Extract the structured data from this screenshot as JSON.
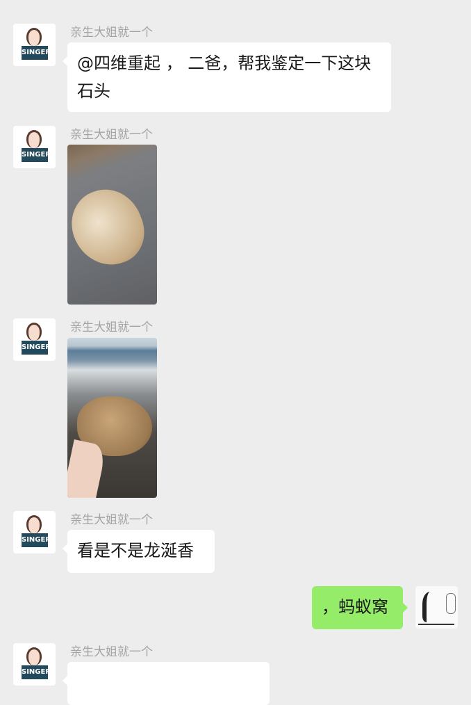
{
  "messages": [
    {
      "sender": "亲生大姐就一个",
      "side": "left",
      "type": "text",
      "text": "@四维重起 ， 二爸，帮我鉴定一下这块石头"
    },
    {
      "sender": "亲生大姐就一个",
      "side": "left",
      "type": "image",
      "icon": "photo-stone-on-sand"
    },
    {
      "sender": "亲生大姐就一个",
      "side": "left",
      "type": "image",
      "icon": "photo-stone-in-hand-beach"
    },
    {
      "sender": "亲生大姐就一个",
      "side": "left",
      "type": "text",
      "text": "看是不是龙涎香"
    },
    {
      "side": "right",
      "type": "text",
      "text": "，蚂蚁窝"
    },
    {
      "sender": "亲生大姐就一个",
      "side": "left",
      "type": "text",
      "text": ""
    }
  ],
  "avatar_logo": "SINGER",
  "colors": {
    "background": "#ededed",
    "sent_bubble": "#95ec69",
    "received_bubble": "#ffffff",
    "sender_name": "#a3a3a3"
  }
}
